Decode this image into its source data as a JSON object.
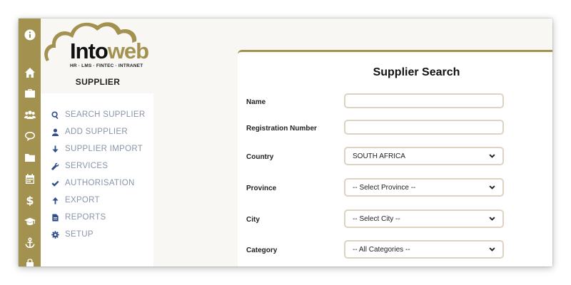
{
  "brand": {
    "name_part1": "Into",
    "name_part2": "web",
    "tagline": "HR · LMS · FINTEC · INTRANET",
    "accent_color": "#a3914f"
  },
  "module_title": "SUPPLIER",
  "rail_icons": [
    "info-icon",
    "home-icon",
    "briefcase-icon",
    "users-icon",
    "chat-icon",
    "folder-icon",
    "calendar-icon",
    "dollar-icon",
    "graduation-cap-icon",
    "anchor-icon",
    "lock-icon"
  ],
  "menu": {
    "items": [
      {
        "label": "SEARCH SUPPLIER",
        "icon": "search-icon"
      },
      {
        "label": "ADD SUPPLIER",
        "icon": "user-icon"
      },
      {
        "label": "SUPPLIER IMPORT",
        "icon": "arrow-down-icon"
      },
      {
        "label": "SERVICES",
        "icon": "wrench-icon"
      },
      {
        "label": "AUTHORISATION",
        "icon": "check-icon"
      },
      {
        "label": "EXPORT",
        "icon": "arrow-up-icon"
      },
      {
        "label": "REPORTS",
        "icon": "file-icon"
      },
      {
        "label": "SETUP",
        "icon": "cog-icon"
      }
    ]
  },
  "form": {
    "title": "Supplier Search",
    "name": {
      "label": "Name",
      "value": ""
    },
    "registration": {
      "label": "Registration Number",
      "value": ""
    },
    "country": {
      "label": "Country",
      "selected": "SOUTH AFRICA"
    },
    "province": {
      "label": "Province",
      "selected": "-- Select Province --"
    },
    "city": {
      "label": "City",
      "selected": "-- Select City --"
    },
    "category": {
      "label": "Category",
      "selected": "-- All Categories --"
    }
  }
}
